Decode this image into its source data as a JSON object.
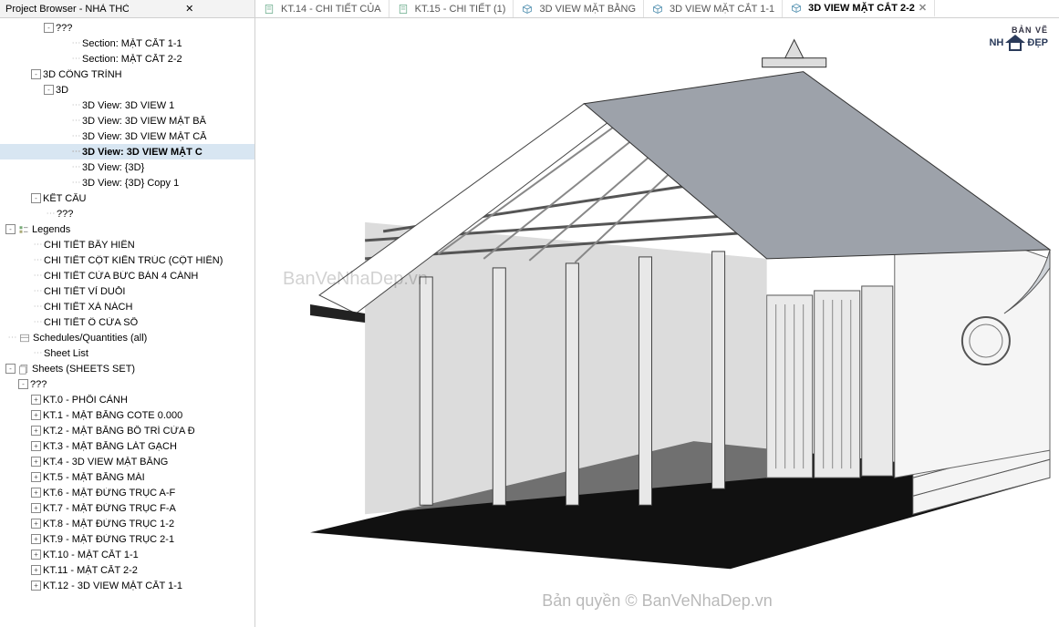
{
  "panel": {
    "title": "Project Browser - NHÀ THỜ HỌ",
    "close": "✕"
  },
  "tabs": [
    {
      "icon": "sheet",
      "label": "KT.14 - CHI TIẾT CỦA",
      "active": false,
      "close": false
    },
    {
      "icon": "sheet",
      "label": "KT.15 - CHI TIẾT (1)",
      "active": false,
      "close": false
    },
    {
      "icon": "3d",
      "label": "3D VIEW MẶT BẰNG",
      "active": false,
      "close": false
    },
    {
      "icon": "3d",
      "label": "3D VIEW MẶT CẮT 1-1",
      "active": false,
      "close": false
    },
    {
      "icon": "3d",
      "label": "3D VIEW MẶT CẮT 2-2",
      "active": true,
      "close": true
    }
  ],
  "tree": [
    {
      "d": 3,
      "t": "-",
      "label": "???"
    },
    {
      "d": 5,
      "t": "",
      "label": "Section: MẶT CẮT 1-1"
    },
    {
      "d": 5,
      "t": "",
      "label": "Section: MẶT CẮT 2-2"
    },
    {
      "d": 2,
      "t": "-",
      "label": "3D CÔNG TRÌNH"
    },
    {
      "d": 3,
      "t": "-",
      "label": "3D"
    },
    {
      "d": 5,
      "t": "",
      "label": "3D View: 3D VIEW 1"
    },
    {
      "d": 5,
      "t": "",
      "label": "3D View: 3D VIEW MẶT BẰ"
    },
    {
      "d": 5,
      "t": "",
      "label": "3D View: 3D VIEW MẶT CẮ"
    },
    {
      "d": 5,
      "t": "",
      "label": "3D View: 3D VIEW MẶT C",
      "selected": true
    },
    {
      "d": 5,
      "t": "",
      "label": "3D View: {3D}"
    },
    {
      "d": 5,
      "t": "",
      "label": "3D View: {3D} Copy 1"
    },
    {
      "d": 2,
      "t": "-",
      "label": "KẾT CẤU"
    },
    {
      "d": 3,
      "t": "",
      "label": "???"
    },
    {
      "d": 0,
      "t": "-",
      "icon": "legend",
      "label": "Legends"
    },
    {
      "d": 2,
      "t": "",
      "label": "CHI TIẾT BẨY HIÊN"
    },
    {
      "d": 2,
      "t": "",
      "label": "CHI TIẾT CỘT KIẾN TRÚC (CỘT HIÊN)"
    },
    {
      "d": 2,
      "t": "",
      "label": "CHI TIẾT CỬA BỨC BÀN 4 CÁNH"
    },
    {
      "d": 2,
      "t": "",
      "label": "CHI TIẾT VỈ DUỖI"
    },
    {
      "d": 2,
      "t": "",
      "label": "CHI TIẾT XÀ NÁCH"
    },
    {
      "d": 2,
      "t": "",
      "label": "CHI TIẾT Ô CỬA SỔ"
    },
    {
      "d": 0,
      "t": "",
      "icon": "sched",
      "label": "Schedules/Quantities (all)"
    },
    {
      "d": 2,
      "t": "",
      "label": "Sheet List"
    },
    {
      "d": 0,
      "t": "-",
      "icon": "sheets",
      "label": "Sheets (SHEETS SET)"
    },
    {
      "d": 1,
      "t": "-",
      "label": "???"
    },
    {
      "d": 2,
      "t": "+",
      "label": "KT.0 - PHỐI CẢNH"
    },
    {
      "d": 2,
      "t": "+",
      "label": "KT.1 - MẶT BẰNG COTE 0.000"
    },
    {
      "d": 2,
      "t": "+",
      "label": "KT.2 - MẶT BẰNG BỐ TRÍ CỬA Đ"
    },
    {
      "d": 2,
      "t": "+",
      "label": "KT.3 - MẶT BẰNG LÁT GẠCH"
    },
    {
      "d": 2,
      "t": "+",
      "label": "KT.4 - 3D VIEW MẶT BẰNG"
    },
    {
      "d": 2,
      "t": "+",
      "label": "KT.5 - MẶT BẰNG MÁI"
    },
    {
      "d": 2,
      "t": "+",
      "label": "KT.6 - MẶT ĐỨNG TRỤC A-F"
    },
    {
      "d": 2,
      "t": "+",
      "label": "KT.7 - MẶT ĐỨNG TRỤC F-A"
    },
    {
      "d": 2,
      "t": "+",
      "label": "KT.8 - MẶT ĐỨNG TRỤC 1-2"
    },
    {
      "d": 2,
      "t": "+",
      "label": "KT.9 - MẶT ĐỨNG TRỤC 2-1"
    },
    {
      "d": 2,
      "t": "+",
      "label": "KT.10 - MẶT CẮT 1-1"
    },
    {
      "d": 2,
      "t": "+",
      "label": "KT.11 - MẶT CẮT 2-2"
    },
    {
      "d": 2,
      "t": "+",
      "label": "KT.12 - 3D VIEW MẶT CẮT 1-1"
    }
  ],
  "logo": {
    "line1": "BẢN VẼ",
    "nha": "NH",
    "dep": "ĐẸP"
  },
  "watermark1": "BanVeNhaDep.vn",
  "watermark2": "Bản quyền © BanVeNhaDep.vn"
}
